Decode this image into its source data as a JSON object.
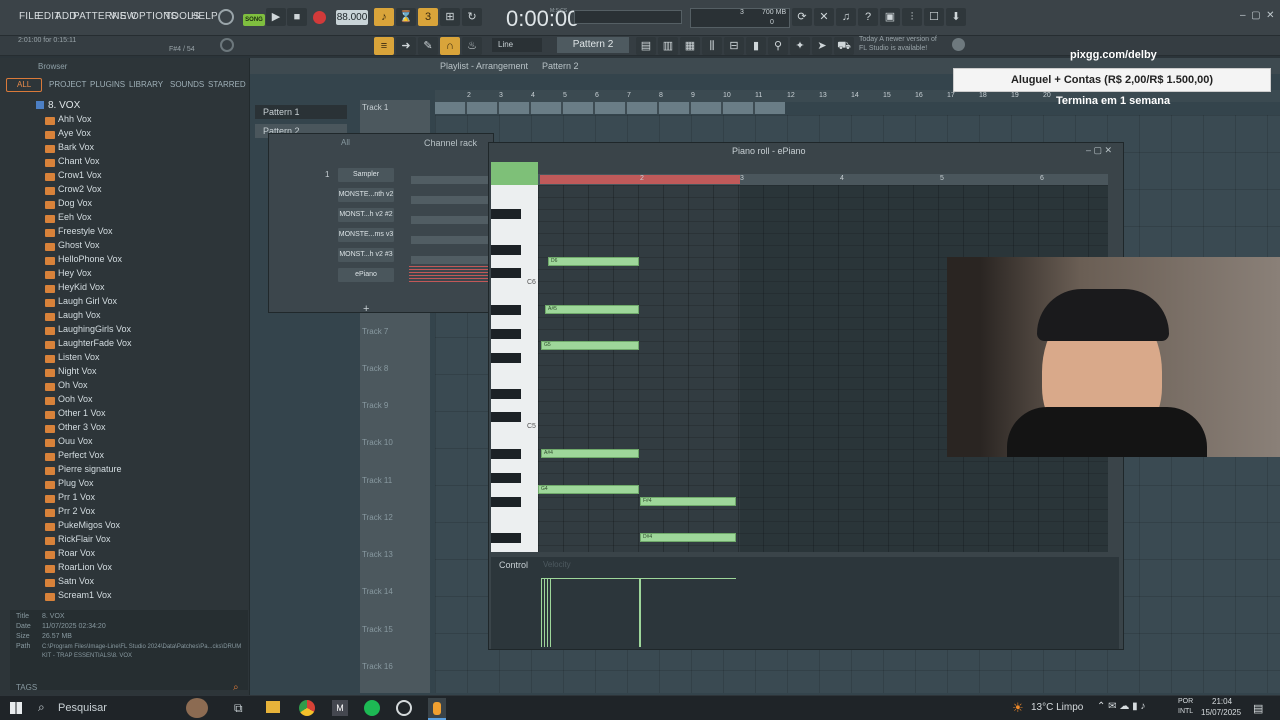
{
  "menu": [
    "FILE",
    "EDIT",
    "ADD",
    "PATTERNS",
    "VIEW",
    "OPTIONS",
    "TOOLS",
    "HELP"
  ],
  "transport": {
    "song_label": "SONG",
    "tempo": "88.000",
    "time": "0:00:00",
    "time_unit": "M:S:CS"
  },
  "hint": {
    "line1": "2:01:00 for 0:15:11",
    "line2": "F#4 / 54"
  },
  "cpu": {
    "val1": "3",
    "val2": "0",
    "mem": "700 MB"
  },
  "news": {
    "line1": "Today  A newer version of",
    "line2": "FL Studio is available!"
  },
  "snap": "Line",
  "pattern_selector": "Pattern 2",
  "overlay": {
    "domain": "pixgg.com/delby",
    "promo": "Aluguel + Contas (R$ 2,00/R$ 1.500,00)",
    "subtitle": "Termina em 1 semana"
  },
  "browser": {
    "title": "Browser",
    "tabs": [
      "ALL",
      "PROJECT",
      "PLUGINS",
      "LIBRARY",
      "SOUNDS",
      "STARRED"
    ],
    "folder": "8. VOX",
    "items": [
      "Ahh Vox",
      "Aye Vox",
      "Bark Vox",
      "Chant Vox",
      "Crow1 Vox",
      "Crow2 Vox",
      "Dog Vox",
      "Eeh Vox",
      "Freestyle Vox",
      "Ghost Vox",
      "HelloPhone Vox",
      "Hey Vox",
      "HeyKid Vox",
      "Laugh Girl Vox",
      "Laugh Vox",
      "LaughingGirls Vox",
      "LaughterFade Vox",
      "Listen Vox",
      "Night Vox",
      "Oh Vox",
      "Ooh Vox",
      "Other 1 Vox",
      "Other 3 Vox",
      "Ouu Vox",
      "Perfect Vox",
      "Pierre signature",
      "Plug Vox",
      "Prr 1 Vox",
      "Prr 2 Vox",
      "PukeMigos Vox",
      "RickFlair Vox",
      "Roar Vox",
      "RoarLion Vox",
      "Satn Vox",
      "Scream1 Vox"
    ],
    "info": {
      "title_k": "Title",
      "title_v": "8. VOX",
      "date_k": "Date",
      "date_v": "11/07/2025 02:34:20",
      "size_k": "Size",
      "size_v": "26.57 MB",
      "path_k": "Path",
      "path_v": "C:\\Program Files\\Image-Line\\FL Studio 2024\\Data\\Patches\\Pa...cks\\DRUM KIT - TRAP ESSENTIALS\\8. VOX"
    },
    "tags": "TAGS"
  },
  "playlist": {
    "title": "Playlist - Arrangement",
    "pattern": "Pattern 2",
    "patterns": [
      "Pattern 1",
      "Pattern 2"
    ],
    "tracks": [
      "Track 1",
      "Track 7",
      "Track 8",
      "Track 9",
      "Track 10",
      "Track 11",
      "Track 12",
      "Track 13",
      "Track 14",
      "Track 15",
      "Track 16"
    ],
    "ruler": [
      "2",
      "3",
      "4",
      "5",
      "6",
      "7",
      "8",
      "9",
      "10",
      "11",
      "12",
      "13",
      "14",
      "15",
      "16",
      "17",
      "18",
      "19",
      "20"
    ]
  },
  "channel_rack": {
    "title": "Channel rack",
    "filter": "All",
    "channels": [
      "Sampler",
      "MONSTE...nth v2",
      "MONST...h v2 #2",
      "MONSTE...ms v3",
      "MONST...h v2 #3",
      "ePiano"
    ],
    "first_num": "1"
  },
  "piano_roll": {
    "title": "Piano roll - ePiano",
    "ruler": [
      "2",
      "3",
      "4",
      "5",
      "6"
    ],
    "octaves": [
      "C6",
      "C5"
    ],
    "notes": [
      {
        "label": "D6"
      },
      {
        "label": "A#5"
      },
      {
        "label": "G5"
      },
      {
        "label": "A#4"
      },
      {
        "label": "G4"
      },
      {
        "label": "F#4"
      },
      {
        "label": "D#4"
      }
    ],
    "control_label": "Control",
    "control_param": "Velocity"
  },
  "taskbar": {
    "search": "Pesquisar",
    "weather": "13°C  Limpo",
    "lang1": "POR",
    "lang2": "INTL",
    "time": "21:04",
    "date": "15/07/2025"
  }
}
